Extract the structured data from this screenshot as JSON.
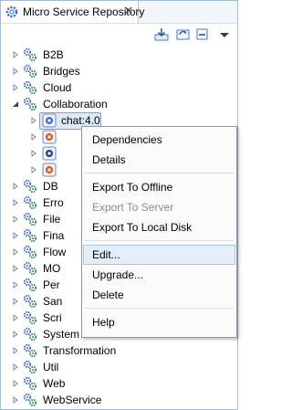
{
  "view": {
    "title": "Micro Service Repository",
    "toolbar": [
      "import-icon",
      "sync-icon",
      "minimize-icon",
      "view-menu-icon"
    ]
  },
  "tree": {
    "items": [
      {
        "label": "B2B"
      },
      {
        "label": "Bridges"
      },
      {
        "label": "Cloud"
      },
      {
        "label": "Collaboration",
        "expanded": true
      },
      {
        "label": "chat:4.0",
        "child": true,
        "selected": true
      },
      {
        "label": "",
        "child": true
      },
      {
        "label": "",
        "child": true
      },
      {
        "label": "",
        "child": true
      },
      {
        "label": "DB"
      },
      {
        "label": "Erro"
      },
      {
        "label": "File"
      },
      {
        "label": "Fina"
      },
      {
        "label": "Flow"
      },
      {
        "label": "MO"
      },
      {
        "label": "Per"
      },
      {
        "label": "San"
      },
      {
        "label": "Scri"
      },
      {
        "label": "System Lib"
      },
      {
        "label": "Transformation"
      },
      {
        "label": "Util"
      },
      {
        "label": "Web"
      },
      {
        "label": "WebService"
      }
    ]
  },
  "context_menu": {
    "groups": [
      [
        {
          "label": "Dependencies"
        },
        {
          "label": "Details"
        }
      ],
      [
        {
          "label": "Export To Offline"
        },
        {
          "label": "Export To Server",
          "disabled": true
        },
        {
          "label": "Export To Local Disk"
        }
      ],
      [
        {
          "label": "Edit...",
          "hover": true
        },
        {
          "label": "Upgrade..."
        },
        {
          "label": "Delete"
        }
      ],
      [
        {
          "label": "Help"
        }
      ]
    ]
  },
  "colors": {
    "selection": "#dce9f9",
    "selection_border": "#7da2ce",
    "gear": "#3b6cc4",
    "menu_hover": "#e3eef9"
  }
}
